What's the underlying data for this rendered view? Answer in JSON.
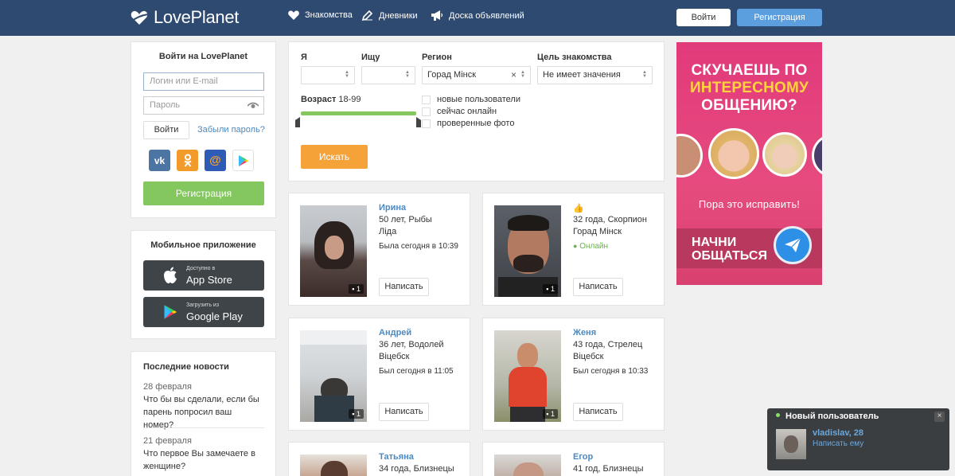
{
  "header": {
    "logo": "LovePlanet",
    "nav": [
      "Знакомства",
      "Дневники",
      "Доска объявлений"
    ],
    "login_button": "Войти",
    "register_button": "Регистрация"
  },
  "login": {
    "title": "Войти на LovePlanet",
    "login_placeholder": "Логин или E-mail",
    "password_placeholder": "Пароль",
    "submit": "Войти",
    "forgot": "Забыли пароль?",
    "register": "Регистрация",
    "social": [
      "vk-icon",
      "odnoklassniki-icon",
      "mailru-icon",
      "google-play-icon"
    ]
  },
  "mobile": {
    "title": "Мобильное приложение",
    "appstore_small": "Доступно в",
    "appstore_big": "App Store",
    "googleplay_small": "Загрузить из",
    "googleplay_big": "Google Play"
  },
  "news": {
    "title": "Последние новости",
    "items": [
      {
        "date": "28 февраля",
        "text": "Что бы вы сделали, если бы парень попросил ваш номер?"
      },
      {
        "date": "21 февраля",
        "text": "Что первое Вы замечаете в женщине?"
      }
    ]
  },
  "filter": {
    "i_label": "Я",
    "seek_label": "Ищу",
    "region_label": "Регион",
    "region_value": "Горад Мінск",
    "goal_label": "Цель знакомства",
    "goal_value": "Не имеет значения",
    "age_label": "Возраст",
    "age_value": "18-99",
    "age_range": [
      18,
      99
    ],
    "checks": [
      "новые пользователи",
      "сейчас онлайн",
      "проверенные фото"
    ],
    "search_button": "Искать"
  },
  "profiles": [
    {
      "name": "Ирина",
      "info": "50 лет, Рыбы",
      "city": "Ліда",
      "status": "Была сегодня в 10:39",
      "photos": "1",
      "write": "Написать"
    },
    {
      "name": "👍",
      "info": "32 года, Скорпион",
      "city": "Горад Мінск",
      "status": "Онлайн",
      "photos": "1",
      "write": "Написать"
    },
    {
      "name": "Андрей",
      "info": "36 лет, Водолей",
      "city": "Віцебск",
      "status": "Был сегодня в 11:05",
      "photos": "1",
      "write": "Написать"
    },
    {
      "name": "Женя",
      "info": "43 года, Стрелец",
      "city": "Віцебск",
      "status": "Был сегодня в 10:33",
      "photos": "1",
      "write": "Написать"
    },
    {
      "name": "Татьяна",
      "info": "34 года, Близнецы",
      "city": "",
      "status": "",
      "photos": "",
      "write": ""
    },
    {
      "name": "Егор",
      "info": "41 год, Близнецы",
      "city": "",
      "status": "",
      "photos": "",
      "write": ""
    }
  ],
  "ad": {
    "line1": "СКУЧАЕШЬ ПО",
    "line2": "ИНТЕРЕСНОМУ",
    "line3": "ОБЩЕНИЮ?",
    "middle": "Пора это исправить!",
    "cta1": "НАЧНИ",
    "cta2": "ОБЩАТЬСЯ"
  },
  "popup": {
    "title": "Новый пользователь",
    "user": "vladislav, 28",
    "action": "Написать ему"
  },
  "colors": {
    "header": "#2e4a70",
    "link": "#4a8ac4",
    "green": "#84c75f",
    "orange": "#f5a338",
    "ad_pink": "#e13a7b"
  }
}
